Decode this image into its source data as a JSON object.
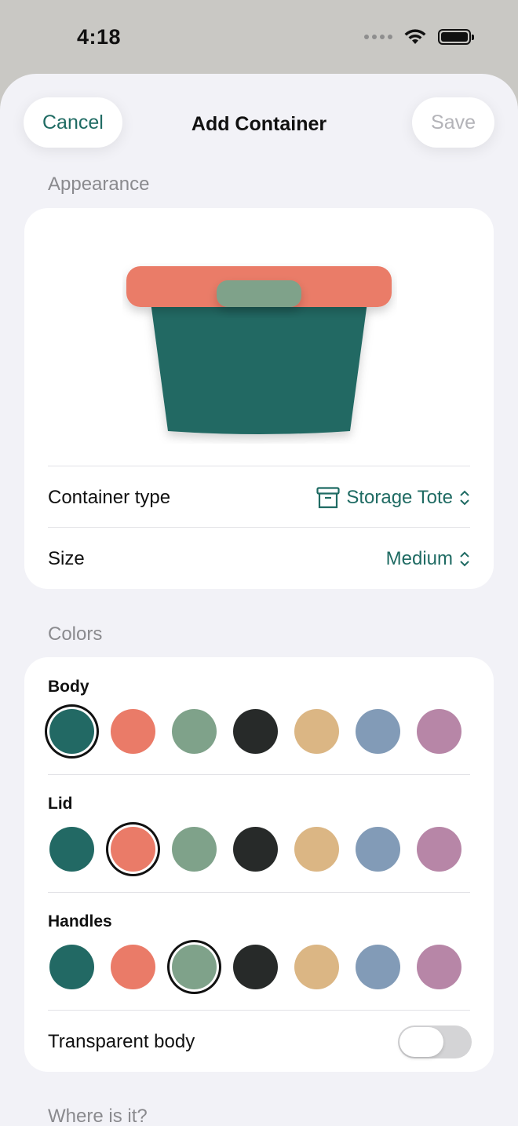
{
  "status": {
    "time": "4:18"
  },
  "nav": {
    "cancel_label": "Cancel",
    "title": "Add Container",
    "save_label": "Save"
  },
  "appearance": {
    "header": "Appearance",
    "container_type": {
      "label": "Container type",
      "value": "Storage Tote",
      "icon": "archive-box-icon"
    },
    "size": {
      "label": "Size",
      "value": "Medium"
    }
  },
  "preview": {
    "body_color": "#226964",
    "lid_color": "#ea7b68",
    "handle_color": "#7fa28a"
  },
  "colors": {
    "header": "Colors",
    "palette": [
      "#226964",
      "#ea7b68",
      "#7fa28a",
      "#272a29",
      "#dbb684",
      "#829bb7",
      "#b786a7"
    ],
    "groups": [
      {
        "label": "Body",
        "selected_index": 0
      },
      {
        "label": "Lid",
        "selected_index": 1
      },
      {
        "label": "Handles",
        "selected_index": 2
      }
    ],
    "transparent_body": {
      "label": "Transparent body",
      "on": false
    }
  },
  "location": {
    "header": "Where is it?"
  }
}
